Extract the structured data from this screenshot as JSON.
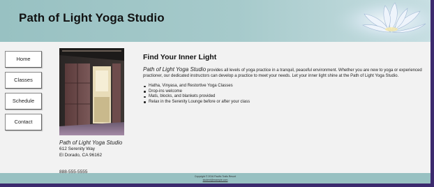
{
  "header": {
    "site_title": "Path of Light Yoga Studio"
  },
  "nav": {
    "items": [
      {
        "label": "Home"
      },
      {
        "label": "Classes"
      },
      {
        "label": "Schedule"
      },
      {
        "label": "Contact"
      }
    ]
  },
  "sidebar": {
    "studio_name": "Path of Light Yoga Studio",
    "street": "612 Serenity Way",
    "city": "El Dorado, CA 96162",
    "phone": "888-555-5555"
  },
  "content": {
    "heading": "Find Your Inner Light",
    "intro_lead": "Path of Light Yoga Studio",
    "intro_rest": " provides all levels of yoga practice in a tranquil, peaceful environment. Whether you are new to yoga or experienced practioner, our dedicated instructors can develop a practice to meet your needs. Let your inner light shine at the Path of Light Yoga Studio.",
    "features": [
      "Hatha, Vinyasa, and Restortive Yoga Classes",
      "Drop-ins welcome",
      "Mats, blocks, and blankets provided",
      "Relax in the Serenity Lounge before or after your class"
    ]
  },
  "footer": {
    "copyright": "Copyright © 2016 Pacific Trails Resort",
    "email": "student@example.com"
  },
  "colors": {
    "header_teal": "#98c1c2",
    "frame_purple": "#3c2a6e",
    "content_bg": "#f2f2f2"
  }
}
